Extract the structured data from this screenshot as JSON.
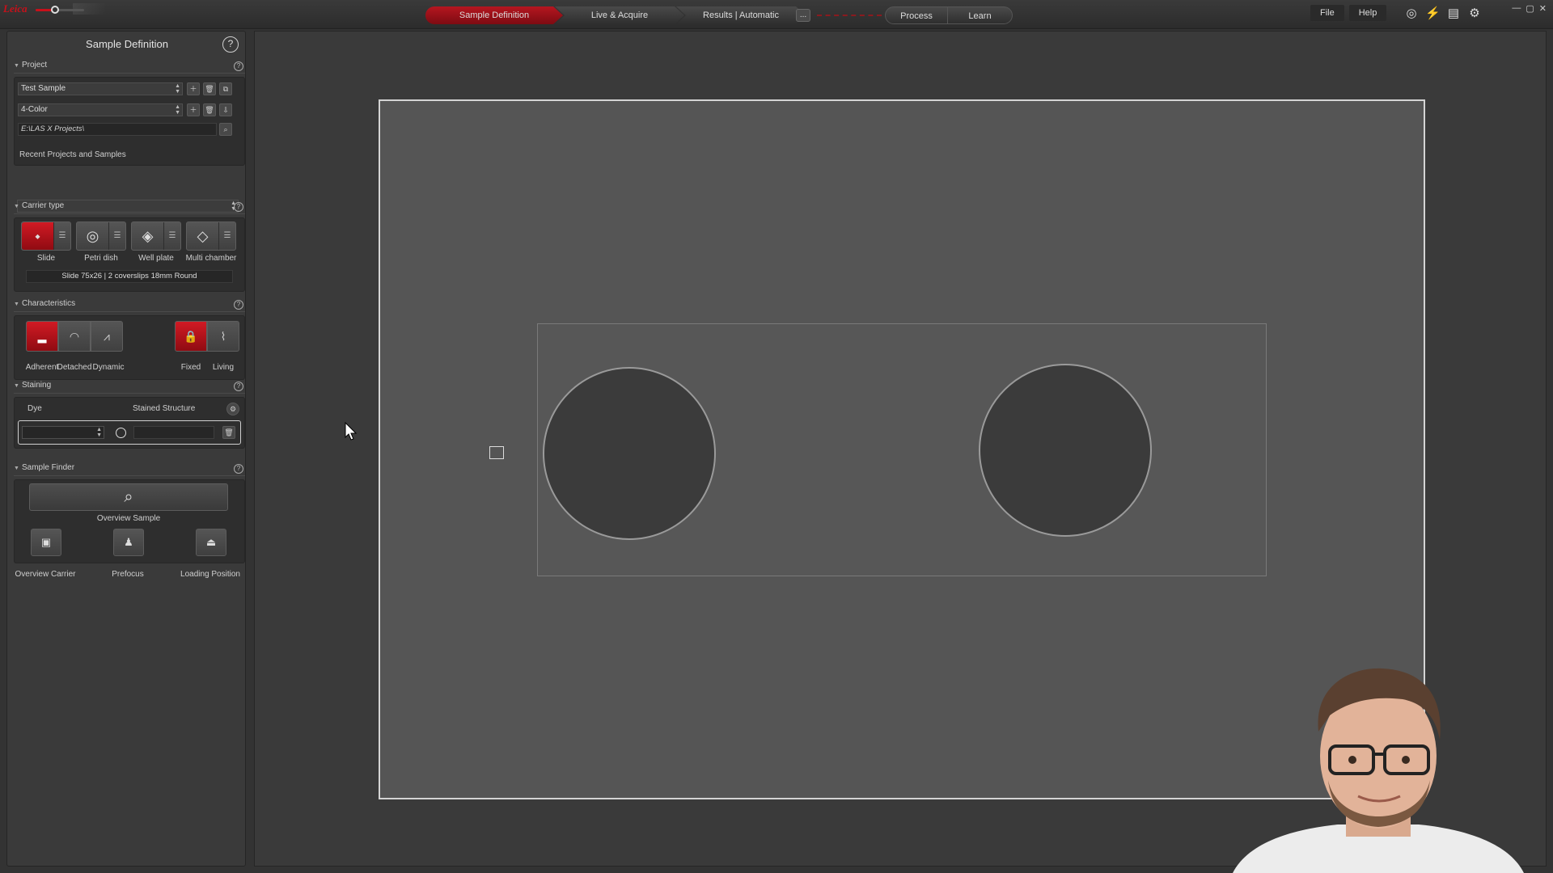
{
  "topbar": {
    "workflow": {
      "sample_definition": "Sample Definition",
      "live_acquire": "Live & Acquire",
      "results": "Results | Automatic",
      "more": "...",
      "process": "Process",
      "learn": "Learn"
    },
    "menu": {
      "file": "File",
      "help": "Help"
    }
  },
  "panel": {
    "title": "Sample Definition",
    "help": "?",
    "project": {
      "header": "Project",
      "sample_name": "Test Sample",
      "experiment": "4-Color",
      "path": "E:\\LAS X Projects\\",
      "recent_label": "Recent Projects and Samples",
      "recent_value": ""
    },
    "carrier_type": {
      "header": "Carrier type",
      "items": [
        {
          "label": "Slide",
          "active": true
        },
        {
          "label": "Petri dish",
          "active": false
        },
        {
          "label": "Well plate",
          "active": false
        },
        {
          "label": "Multi chamber",
          "active": false
        }
      ],
      "selection": "Slide 75x26 | 2 coverslips 18mm Round"
    },
    "characteristics": {
      "header": "Characteristics",
      "adherent": "Adherent",
      "detached": "Detached",
      "dynamic": "Dynamic",
      "fixed": "Fixed",
      "living": "Living"
    },
    "staining": {
      "header": "Staining",
      "dye_label": "Dye",
      "structure_label": "Stained Structure"
    },
    "sample_finder": {
      "header": "Sample Finder",
      "overview_sample": "Overview Sample",
      "overview_carrier": "Overview Carrier",
      "prefocus": "Prefocus",
      "loading_position": "Loading Position"
    }
  },
  "colors": {
    "accent": "#c8101a",
    "panel": "#3a3a3a",
    "carrier": "#555555"
  },
  "icons": [
    "search-icon",
    "help-icon",
    "slide-icon",
    "petri-dish-icon",
    "well-plate-icon",
    "multi-chamber-icon",
    "lock-icon",
    "pulse-icon",
    "gear-icon",
    "trash-icon"
  ]
}
